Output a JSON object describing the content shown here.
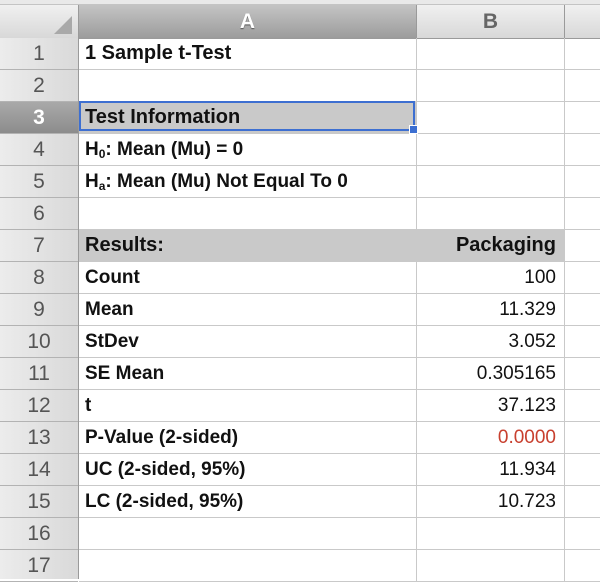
{
  "columns": {
    "a": "A",
    "b": "B"
  },
  "row_numbers": [
    "1",
    "2",
    "3",
    "4",
    "5",
    "6",
    "7",
    "8",
    "9",
    "10",
    "11",
    "12",
    "13",
    "14",
    "15",
    "16",
    "17"
  ],
  "cells": {
    "a1": "1 Sample t-Test",
    "a3": "Test Information",
    "a4_prefix": "H",
    "a4_sub": "0",
    "a4_rest": ": Mean (Mu) = 0",
    "a5_prefix": "H",
    "a5_sub": "a",
    "a5_rest": ": Mean (Mu) Not Equal To 0",
    "a7": "Results:",
    "b7": "Packaging"
  },
  "results": [
    {
      "label": "Count",
      "value": "100"
    },
    {
      "label": "Mean",
      "value": "11.329"
    },
    {
      "label": "StDev",
      "value": "3.052"
    },
    {
      "label": "SE Mean",
      "value": "0.305165"
    },
    {
      "label": "t",
      "value": "37.123"
    },
    {
      "label": "P-Value (2-sided)",
      "value": "0.0000"
    },
    {
      "label": "UC (2-sided, 95%)",
      "value": "11.934"
    },
    {
      "label": "LC (2-sided, 95%)",
      "value": "10.723"
    }
  ],
  "colors": {
    "selection": "#3d6fd1",
    "pvalue": "#c8402f",
    "shaded": "#c9c9c9"
  }
}
